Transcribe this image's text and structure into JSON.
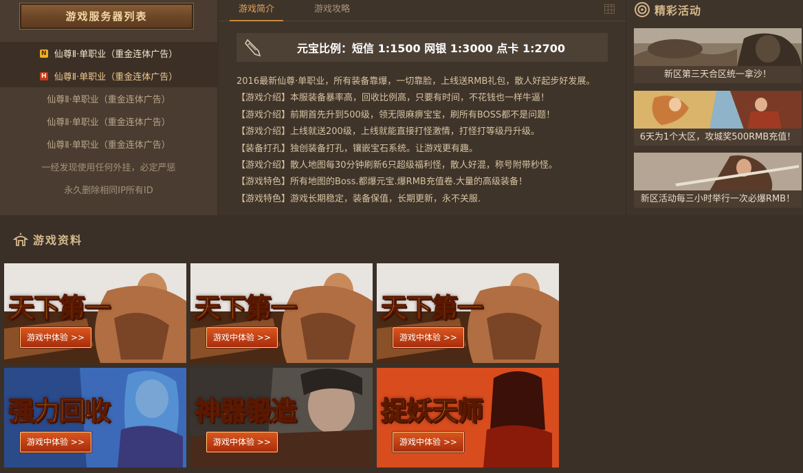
{
  "server_panel": {
    "title": "游戏服务器列表",
    "items": [
      {
        "badge": "N",
        "label": "仙尊Ⅱ·单职业（重金连体广告）"
      },
      {
        "badge": "H",
        "label": "仙尊Ⅱ·单职业（重金连体广告）"
      },
      {
        "label": "仙尊Ⅱ·单职业（重金连体广告）"
      },
      {
        "label": "仙尊Ⅱ·单职业（重金连体广告）"
      },
      {
        "label": "仙尊Ⅱ·单职业（重金连体广告）"
      }
    ],
    "notes": [
      "一经发现使用任何外挂，必定严惩",
      "永久删除相同IP所有ID"
    ]
  },
  "tabs": [
    {
      "label": "游戏简介"
    },
    {
      "label": "游戏攻略"
    }
  ],
  "ratio": {
    "text": "元宝比例：短信 1:1500 网银 1:3000 点卡 1:2700"
  },
  "intro_lines": [
    "2016最新仙尊·单职业，所有装备靠爆，一切靠脸，上线送RMB礼包，散人好起步好发展。",
    "【游戏介绍】本服装备暴率高，回收比例高，只要有时间，不花钱也一样牛逼！",
    "【游戏介绍】前期首先升到500级，领无限麻痹宝宝，刷所有BOSS都不是问题！",
    "【游戏介绍】上线就送200级，上线就能直接打怪激情，打怪打等级丹升级。",
    "【装备打孔】独创装备打孔，镶嵌宝石系统。让游戏更有趣。",
    "【游戏介绍】散人地图每30分钟刷新6只超级福利怪，散人好混，称号附带秒怪。",
    "【游戏特色】所有地图的Boss.都爆元宝.爆RMB充值卷.大量的高级装备！",
    "【游戏特色】游戏长期稳定，装备保值，长期更新，永不关服."
  ],
  "activities": {
    "title": "精彩活动",
    "items": [
      {
        "caption": "新区第三天合区统一拿沙！"
      },
      {
        "caption": "6天为1个大区，攻城奖500RMB充值！"
      },
      {
        "caption": "新区活动每三小时举行一次必爆RMB！"
      }
    ]
  },
  "game_info": {
    "title": "游戏资料",
    "banners": [
      {
        "title": "天下第一",
        "button": "游戏中体验 >>"
      },
      {
        "title": "天下第一",
        "button": "游戏中体验 >>"
      },
      {
        "title": "天下第一",
        "button": "游戏中体验 >>"
      },
      {
        "title": "强力回收",
        "button": "游戏中体验 >>"
      },
      {
        "title": "神器锻造",
        "button": "游戏中体验 >>"
      },
      {
        "title": "捉妖天师",
        "button": "游戏中体验 >>"
      }
    ]
  },
  "colors": {
    "background": "#3a3027",
    "accent": "#c98a3c",
    "button": "#c2421a"
  }
}
